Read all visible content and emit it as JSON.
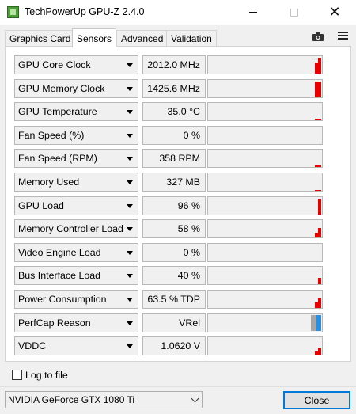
{
  "window": {
    "title": "TechPowerUp GPU-Z 2.4.0",
    "minimize_icon": "minimize-icon",
    "maximize_icon": "maximize-icon",
    "close_icon": "close-icon",
    "close_glyph": "✕"
  },
  "tabs": [
    {
      "label": "Graphics Card",
      "active": false
    },
    {
      "label": "Sensors",
      "active": true
    },
    {
      "label": "Advanced",
      "active": false
    },
    {
      "label": "Validation",
      "active": false
    }
  ],
  "toolbar_icons": [
    "camera-icon",
    "hamburger-menu-icon"
  ],
  "colors": {
    "graph_bar": "#e60000",
    "perfcap_vrel": "#2a8fe0",
    "perfcap_idle": "#a6a6a6",
    "accent": "#0078d7"
  },
  "sensors": [
    {
      "label": "GPU Core Clock",
      "value": "2012.0 MHz",
      "graph": [
        0.7,
        1.0
      ]
    },
    {
      "label": "GPU Memory Clock",
      "value": "1425.6 MHz",
      "graph": [
        1.0,
        1.0
      ]
    },
    {
      "label": "GPU Temperature",
      "value": "35.0 °C",
      "graph": [
        0.1,
        0.1
      ]
    },
    {
      "label": "Fan Speed (%)",
      "value": "0 %",
      "graph": []
    },
    {
      "label": "Fan Speed (RPM)",
      "value": "358 RPM",
      "graph": [
        0.12,
        0.12
      ]
    },
    {
      "label": "Memory Used",
      "value": "327 MB",
      "graph": [
        0.05,
        0.05
      ]
    },
    {
      "label": "GPU Load",
      "value": "96 %",
      "graph": [
        0.96
      ]
    },
    {
      "label": "Memory Controller Load",
      "value": "58 %",
      "graph": [
        0.3,
        0.58
      ]
    },
    {
      "label": "Video Engine Load",
      "value": "0 %",
      "graph": []
    },
    {
      "label": "Bus Interface Load",
      "value": "40 %",
      "graph": [
        0.4
      ]
    },
    {
      "label": "Power Consumption",
      "value": "63.5 % TDP",
      "graph": [
        0.35,
        0.63
      ]
    },
    {
      "label": "PerfCap Reason",
      "value": "VRel",
      "graph": [],
      "perfcap": true
    },
    {
      "label": "VDDC",
      "value": "1.0620 V",
      "graph": [
        0.2,
        0.45
      ]
    }
  ],
  "log_to_file": {
    "label": "Log to file",
    "checked": false
  },
  "gpu_selector": {
    "value": "NVIDIA GeForce GTX 1080 Ti"
  },
  "close_button": {
    "label": "Close"
  }
}
